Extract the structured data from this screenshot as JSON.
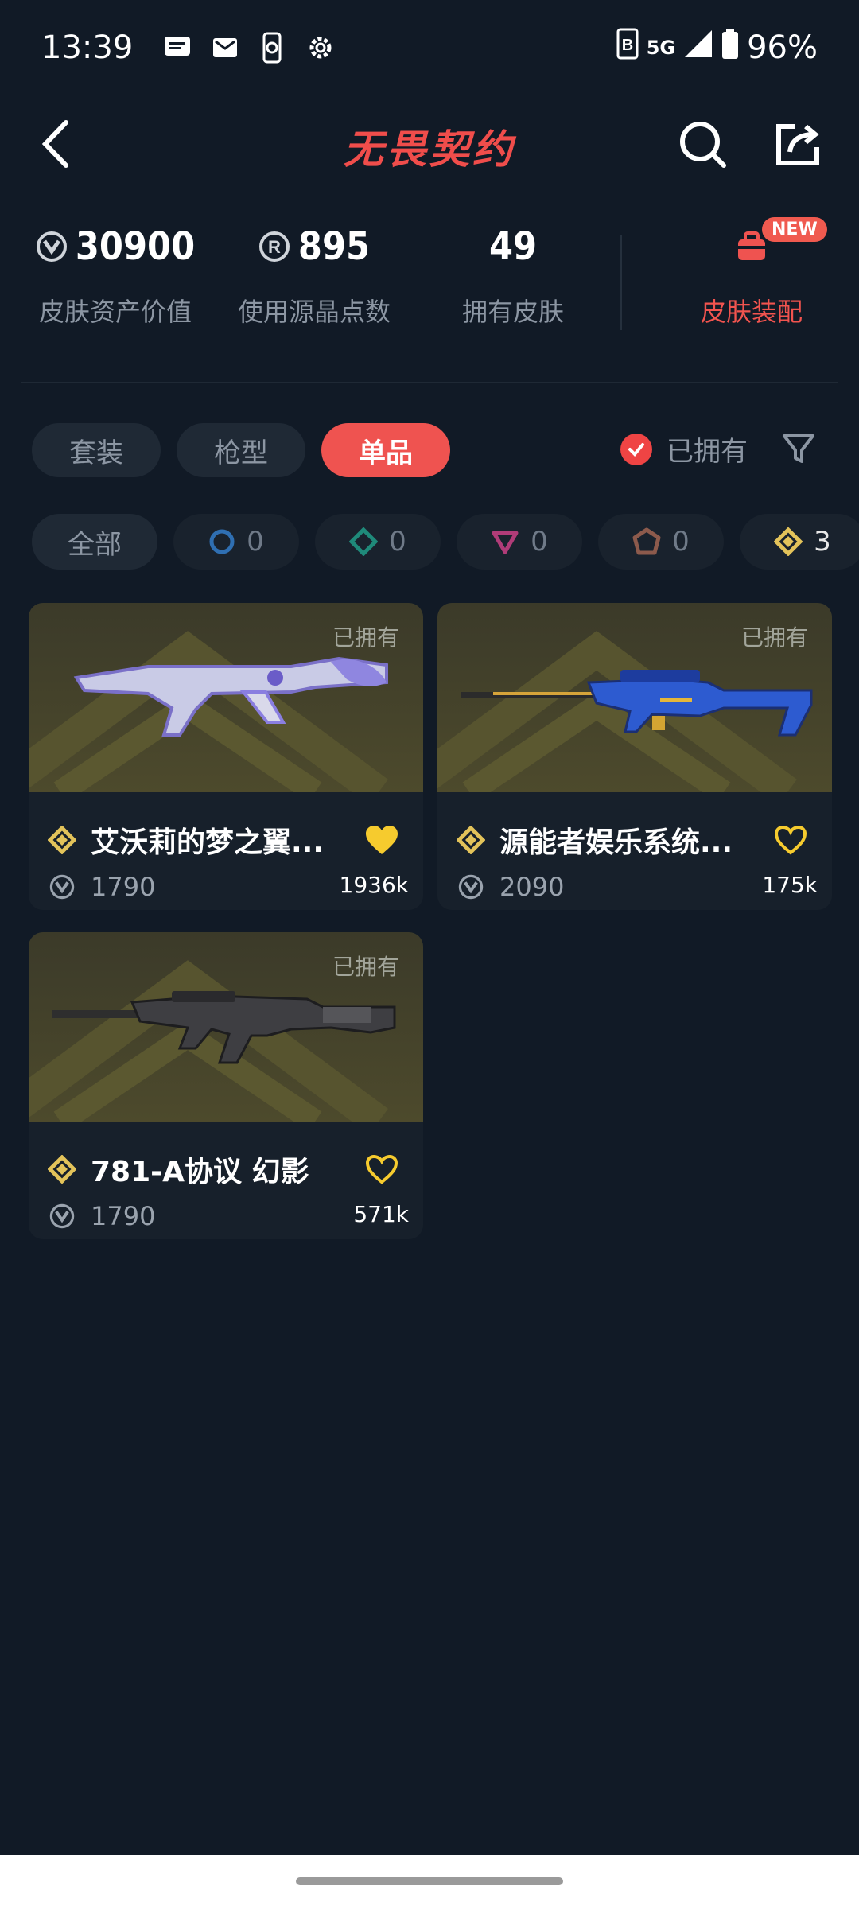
{
  "status_bar": {
    "time": "13:39",
    "network": "5G",
    "battery": "96%"
  },
  "header": {
    "title": "无畏契约"
  },
  "stats": [
    {
      "icon": "valorant-points-icon",
      "value": "30900",
      "label": "皮肤资产价值"
    },
    {
      "icon": "radianite-icon",
      "value": "895",
      "label": "使用源晶点数"
    },
    {
      "icon": "",
      "value": "49",
      "label": "拥有皮肤"
    }
  ],
  "outfit": {
    "label": "皮肤装配",
    "badge": "NEW"
  },
  "tabs": [
    {
      "label": "套装",
      "active": false
    },
    {
      "label": "枪型",
      "active": false
    },
    {
      "label": "单品",
      "active": true
    }
  ],
  "owned_filter": {
    "label": "已拥有",
    "checked": true
  },
  "tiers": [
    {
      "label": "全部"
    },
    {
      "icon": "select-tier-icon",
      "count": "0",
      "color": "#2f6fb2"
    },
    {
      "icon": "deluxe-tier-icon",
      "count": "0",
      "color": "#1f8a7a"
    },
    {
      "icon": "premium-tier-icon",
      "count": "0",
      "color": "#b03c78"
    },
    {
      "icon": "ultra-tier-icon",
      "count": "0",
      "color": "#8c5a4c"
    },
    {
      "icon": "exclusive-tier-icon",
      "count": "3",
      "color": "#e3c35a"
    }
  ],
  "cards": [
    {
      "owned": "已拥有",
      "name": "艾沃莉的梦之翼...",
      "price": "1790",
      "likes": "1936k",
      "liked": true
    },
    {
      "owned": "已拥有",
      "name": "源能者娱乐系统...",
      "price": "2090",
      "likes": "175k",
      "liked": false
    },
    {
      "owned": "已拥有",
      "name": "781-A协议 幻影",
      "price": "1790",
      "likes": "571k",
      "liked": false
    }
  ],
  "colors": {
    "accent": "#ef5350",
    "gold": "#e8c452",
    "background": "#111a26"
  }
}
